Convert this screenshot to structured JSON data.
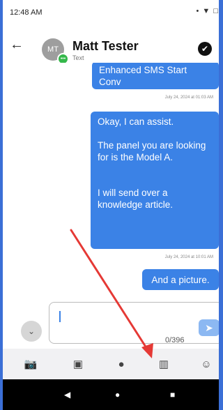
{
  "status_bar": {
    "time": "12:48 AM",
    "icons": "• ▼ □"
  },
  "header": {
    "back_icon": "←",
    "avatar_initials": "MT",
    "contact_name": "Matt Tester",
    "contact_subtitle": "Text",
    "check_icon": "✔"
  },
  "messages": [
    {
      "text": "Enhanced SMS Start\nConv",
      "timestamp": "July 24, 2024 at 01:03 AM"
    },
    {
      "text": "Okay, I can assist.\n\nThe panel you are looking for is the Model A.\n\n\nI will send over a knowledge article.",
      "timestamp": "July 24, 2024 at 10:01 AM"
    },
    {
      "text": "And a picture.",
      "timestamp": ""
    }
  ],
  "composer": {
    "counter": "0/396",
    "expand_icon": "⌄",
    "send_icon": "➤"
  },
  "toolbar": {
    "camera_icon": "📷",
    "gallery_icon": "▣",
    "chat_icon": "●",
    "knowledge_icon": "▥",
    "transfer_icon": "☺"
  },
  "nav": {
    "back": "◀",
    "home": "●",
    "recents": "■"
  },
  "colors": {
    "accent": "#3b82e6",
    "frame": "#3b6fd6",
    "annotation_arrow": "#e53935"
  }
}
